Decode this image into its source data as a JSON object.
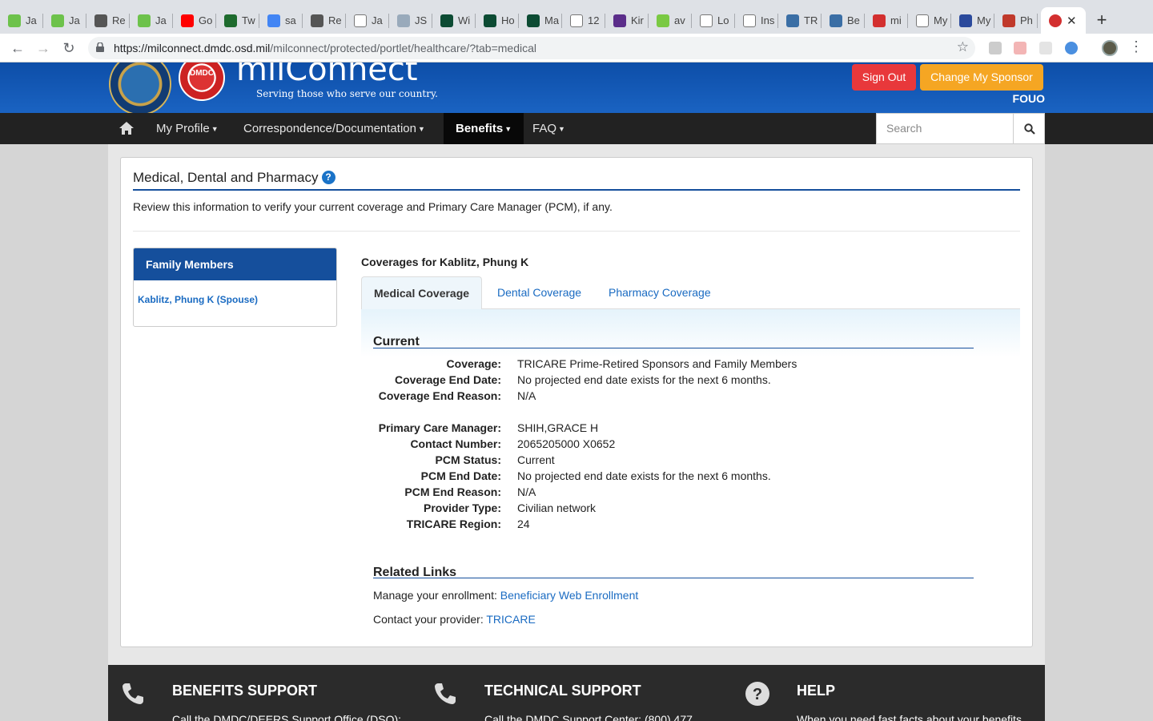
{
  "browser": {
    "tabs": [
      {
        "title": "Ja",
        "icon": "green-tab-icon",
        "color": "#6dc24b"
      },
      {
        "title": "Ja",
        "icon": "green-tab-icon",
        "color": "#6dc24b"
      },
      {
        "title": "Re",
        "icon": "circle-tab-icon",
        "color": "#555555"
      },
      {
        "title": "Ja",
        "icon": "green-tab-icon",
        "color": "#6dc24b"
      },
      {
        "title": "Go",
        "icon": "youtube-icon",
        "color": "#ff0000"
      },
      {
        "title": "Tw",
        "icon": "terminal-tab-icon",
        "color": "#1e6b2e"
      },
      {
        "title": "sa",
        "icon": "docs-icon",
        "color": "#4285f4"
      },
      {
        "title": "Re",
        "icon": "circle-tab-icon",
        "color": "#555555"
      },
      {
        "title": "Ja",
        "icon": "page-icon",
        "color": "#ffffff"
      },
      {
        "title": "JS",
        "icon": "spinner-icon",
        "color": "#9ab"
      },
      {
        "title": "Wi",
        "icon": "django-icon",
        "color": "#0c4b33"
      },
      {
        "title": "Ho",
        "icon": "django-icon",
        "color": "#0c4b33"
      },
      {
        "title": "Ma",
        "icon": "django-icon",
        "color": "#0c4b33"
      },
      {
        "title": "12",
        "icon": "page-icon",
        "color": "#ffffff"
      },
      {
        "title": "Kir",
        "icon": "purple-tab-icon",
        "color": "#5b2d8a"
      },
      {
        "title": "av",
        "icon": "green-tab-icon",
        "color": "#7ac943"
      },
      {
        "title": "Lo",
        "icon": "page-icon",
        "color": "#ffffff"
      },
      {
        "title": "Ins",
        "icon": "page-icon",
        "color": "#ffffff"
      },
      {
        "title": "TR",
        "icon": "globe-icon",
        "color": "#3a6ea5"
      },
      {
        "title": "Be",
        "icon": "globe-icon",
        "color": "#3a6ea5"
      },
      {
        "title": "mi",
        "icon": "dmdc-icon",
        "color": "#d32f2f"
      },
      {
        "title": "My",
        "icon": "page-icon",
        "color": "#ffffff"
      },
      {
        "title": "My",
        "icon": "square-tab-icon",
        "color": "#2b4a9c"
      },
      {
        "title": "Ph",
        "icon": "flag-icon",
        "color": "#c0392b"
      }
    ],
    "active_tab_icon_color": "#d32f2f",
    "url_host": "https://milconnect.dmdc.osd.mil",
    "url_path": "/milconnect/protected/portlet/healthcare/?tab=medical"
  },
  "header": {
    "brand": "milConnect",
    "tagline": "Serving those who serve our country.",
    "seal_text": "DMDC",
    "sign_out": "Sign Out",
    "change_sponsor": "Change My Sponsor",
    "fouo": "FOUO"
  },
  "nav": {
    "items": [
      "My Profile",
      "Correspondence/Documentation",
      "Benefits",
      "FAQ"
    ],
    "active": "Benefits",
    "search_placeholder": "Search"
  },
  "page": {
    "title": "Medical, Dental and Pharmacy",
    "intro": "Review this information to verify your current coverage and Primary Care Manager (PCM), if any.",
    "family_header": "Family Members",
    "family_member": "Kablitz, Phung K (Spouse)",
    "coverage_title": "Coverages for Kablitz, Phung K",
    "tabs": [
      "Medical Coverage",
      "Dental Coverage",
      "Pharmacy Coverage"
    ],
    "current_heading": "Current",
    "coverage_rows": [
      {
        "label": "Coverage:",
        "value": "TRICARE Prime-Retired Sponsors and Family Members"
      },
      {
        "label": "Coverage End Date:",
        "value": "No projected end date exists for the next 6 months."
      },
      {
        "label": "Coverage End Reason:",
        "value": "N/A"
      }
    ],
    "pcm_rows": [
      {
        "label": "Primary Care Manager:",
        "value": "SHIH,GRACE H"
      },
      {
        "label": "Contact Number:",
        "value": "2065205000 X0652"
      },
      {
        "label": "PCM Status:",
        "value": "Current"
      },
      {
        "label": "PCM End Date:",
        "value": "No projected end date exists for the next 6 months."
      },
      {
        "label": "PCM End Reason:",
        "value": "N/A"
      },
      {
        "label": "Provider Type:",
        "value": "Civilian network"
      },
      {
        "label": "TRICARE Region:",
        "value": "24"
      }
    ],
    "related_heading": "Related Links",
    "enroll_prefix": "Manage your enrollment: ",
    "enroll_link": "Beneficiary Web Enrollment",
    "provider_prefix": "Contact your provider: ",
    "provider_link": "TRICARE"
  },
  "footer": {
    "benefits_support": "BENEFITS SUPPORT",
    "benefits_text": "Call the DMDC/DEERS Support Office (DSO):",
    "technical_support": "TECHNICAL SUPPORT",
    "technical_text": "Call the DMDC Support Center: (800) 477",
    "help": "HELP",
    "help_text": "When you need fast facts about your benefits"
  },
  "colors": {
    "header_blue": "#1a63c2",
    "accent_blue": "#154f9c",
    "link_blue": "#1a6bc2",
    "sign_out_red": "#e8383b",
    "sponsor_orange": "#f5a623"
  }
}
